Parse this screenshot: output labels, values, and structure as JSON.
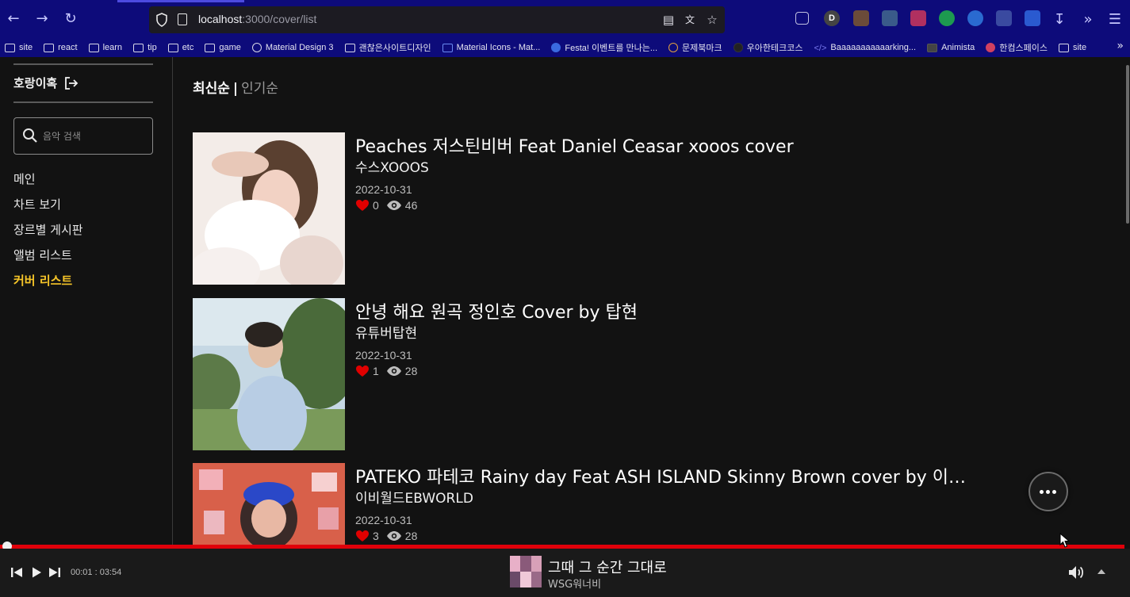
{
  "browser": {
    "url_host": "localhost",
    "url_path": ":3000/cover/list",
    "bookmarks": [
      "site",
      "react",
      "learn",
      "tip",
      "etc",
      "game",
      "Material Design 3",
      "괜찮은사이트디자인",
      "Material Icons - Mat...",
      "Festa! 이벤트를 만나는...",
      "문제북마크",
      "우아한테크코스",
      "Baaaaaaaaaaarking...",
      "Animista",
      "한컴스페이스",
      "site"
    ],
    "ext_d_label": "D"
  },
  "sidebar": {
    "username": "호랑이혹",
    "search_placeholder": "음악 검색",
    "menu": [
      "메인",
      "차트 보기",
      "장르별 게시판",
      "앨범 리스트",
      "커버 리스트"
    ],
    "active_index": 4
  },
  "main": {
    "sort_active": "최신순",
    "sort_separator": "|",
    "sort_inactive": "인기순"
  },
  "covers": [
    {
      "title": "Peaches 저스틴비버 Feat Daniel Ceasar xooos cover",
      "artist": "수스XOOOS",
      "date": "2022-10-31",
      "likes": "0",
      "views": "46"
    },
    {
      "title": "안녕 해요 원곡  정인호 Cover by 탑현",
      "artist": "유튜버탑현",
      "date": "2022-10-31",
      "likes": "1",
      "views": "28"
    },
    {
      "title": "PATEKO 파테코 Rainy day Feat ASH ISLAND Skinny Brown cover by 이비월드EBWORLD",
      "artist": "이비월드EBWORLD",
      "date": "2022-10-31",
      "likes": "3",
      "views": "28"
    }
  ],
  "player": {
    "time": "00:01 : 03:54",
    "progress_fraction": 0.004,
    "title": "그때 그 순간 그대로",
    "artist": "WSG워너비"
  },
  "colors": {
    "accent": "#f6c528",
    "progress": "#e0000a",
    "heart": "#e00000"
  }
}
